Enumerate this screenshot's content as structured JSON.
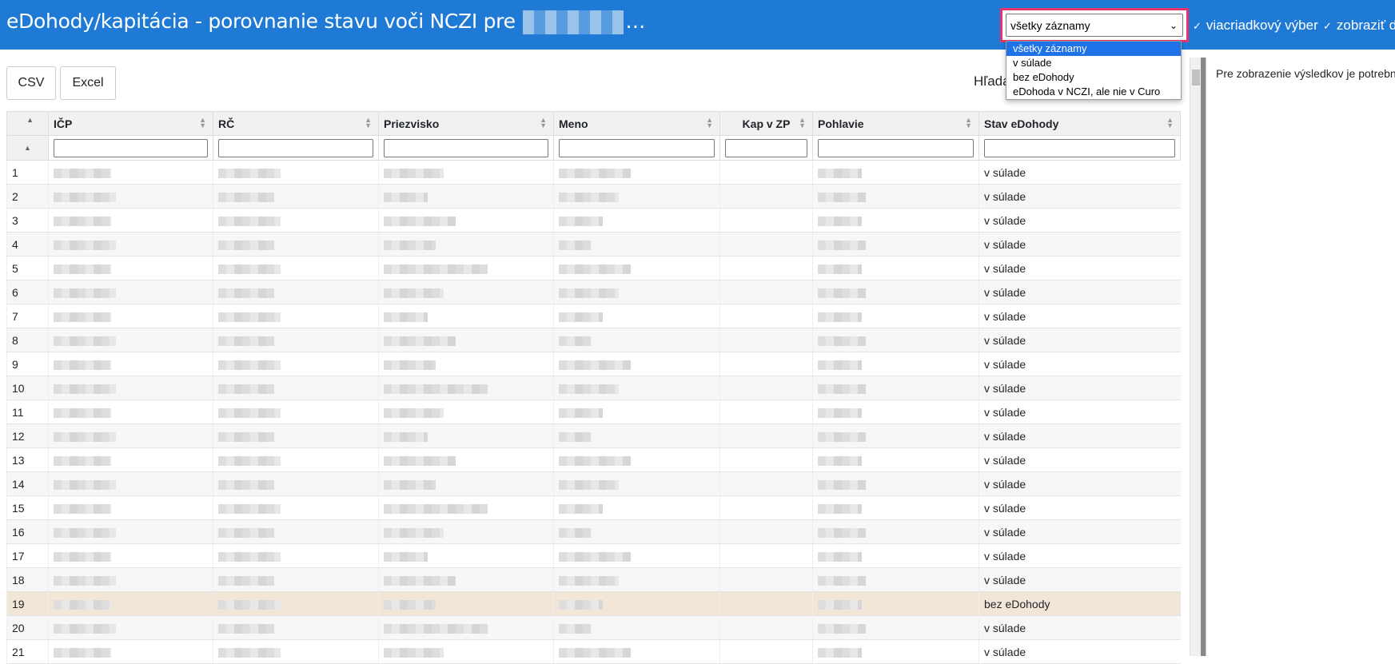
{
  "header": {
    "title": "eDohody/kapitácia - porovnanie stavu voči NCZI pre",
    "ellipsis": "…",
    "filter_selected": "všetky záznamy",
    "filter_options": [
      "všetky záznamy",
      "v súlade",
      "bez eDohody",
      "eDohoda v NCZI, ale nie v Curo"
    ],
    "check_multirow": "viacriadkový výber",
    "check_show": "zobraziť de"
  },
  "toolbar": {
    "csv": "CSV",
    "excel": "Excel",
    "search_label": "Hľada"
  },
  "table": {
    "columns": [
      "IČP",
      "RČ",
      "Priezvisko",
      "Meno",
      "Kap v ZP",
      "Pohlavie",
      "Stav eDohody"
    ],
    "rows": [
      {
        "n": "1",
        "stav": "v súlade"
      },
      {
        "n": "2",
        "stav": "v súlade"
      },
      {
        "n": "3",
        "stav": "v súlade"
      },
      {
        "n": "4",
        "stav": "v súlade"
      },
      {
        "n": "5",
        "stav": "v súlade"
      },
      {
        "n": "6",
        "stav": "v súlade"
      },
      {
        "n": "7",
        "stav": "v súlade"
      },
      {
        "n": "8",
        "stav": "v súlade"
      },
      {
        "n": "9",
        "stav": "v súlade"
      },
      {
        "n": "10",
        "stav": "v súlade"
      },
      {
        "n": "11",
        "stav": "v súlade"
      },
      {
        "n": "12",
        "stav": "v súlade"
      },
      {
        "n": "13",
        "stav": "v súlade"
      },
      {
        "n": "14",
        "stav": "v súlade"
      },
      {
        "n": "15",
        "stav": "v súlade"
      },
      {
        "n": "16",
        "stav": "v súlade"
      },
      {
        "n": "17",
        "stav": "v súlade"
      },
      {
        "n": "18",
        "stav": "v súlade"
      },
      {
        "n": "19",
        "stav": "bez eDohody"
      },
      {
        "n": "20",
        "stav": "v súlade"
      },
      {
        "n": "21",
        "stav": "v súlade"
      }
    ],
    "highlight_color": "#f2e6d8"
  },
  "right_panel": {
    "message": "Pre zobrazenie výsledkov je potrebné"
  },
  "colors": {
    "header_bg": "#1f7ad6",
    "focus_border": "#e6336a",
    "option_selected": "#1e73e8"
  }
}
